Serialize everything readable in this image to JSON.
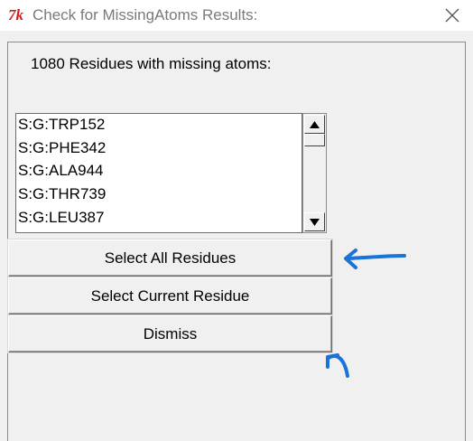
{
  "window": {
    "title": "Check for MissingAtoms Results:",
    "app_icon_glyph": "7k",
    "close_glyph": "×"
  },
  "header": {
    "label": "1080 Residues with missing atoms:"
  },
  "residue_list": {
    "items": [
      "S:G:TRP152",
      "S:G:PHE342",
      "S:G:ALA944",
      "S:G:THR739",
      "S:G:LEU387"
    ]
  },
  "scrollbar": {
    "up_glyph": "▲",
    "down_glyph": "▼"
  },
  "buttons": {
    "select_all": "Select All Residues",
    "select_current": "Select Current Residue",
    "dismiss": "Dismiss"
  },
  "colors": {
    "annotation_arrow": "#1a73d9",
    "app_icon": "#d21e1e",
    "window_bg": "#f0f0f0",
    "title_text": "#7a7a7a"
  },
  "icons": {
    "app": "tk-feather-icon",
    "close": "close-icon",
    "scroll_up": "arrow-up-icon",
    "scroll_down": "arrow-down-icon",
    "annotation_left": "left-arrow-annotation",
    "annotation_curved": "curved-arrow-annotation"
  }
}
